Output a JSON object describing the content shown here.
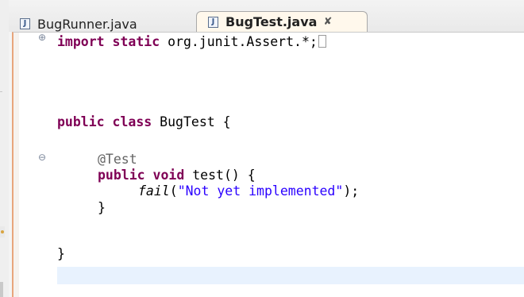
{
  "tabs": [
    {
      "label": "BugRunner.java",
      "icon": "java-file-icon",
      "active": false
    },
    {
      "label": "BugTest.java",
      "icon": "java-file-icon",
      "active": true,
      "close_glyph": "✘"
    }
  ],
  "code": {
    "line1": {
      "kw": "import static",
      "rest": " org.junit.Assert.*;"
    },
    "line2": {
      "kw": "public class",
      "rest": " BugTest {"
    },
    "line3": {
      "text": "@Test"
    },
    "line4": {
      "kw": "public void",
      "rest": " test() {"
    },
    "line5": {
      "method": "fail",
      "open": "(",
      "str": "\"Not yet implemented\"",
      "close": ");"
    },
    "line6": {
      "text": "}"
    },
    "line7": {
      "text": "}"
    }
  },
  "colors": {
    "keyword": "#7f0055",
    "string": "#2a00ff",
    "annotation": "#646464",
    "current_line": "#e8f2fe"
  }
}
